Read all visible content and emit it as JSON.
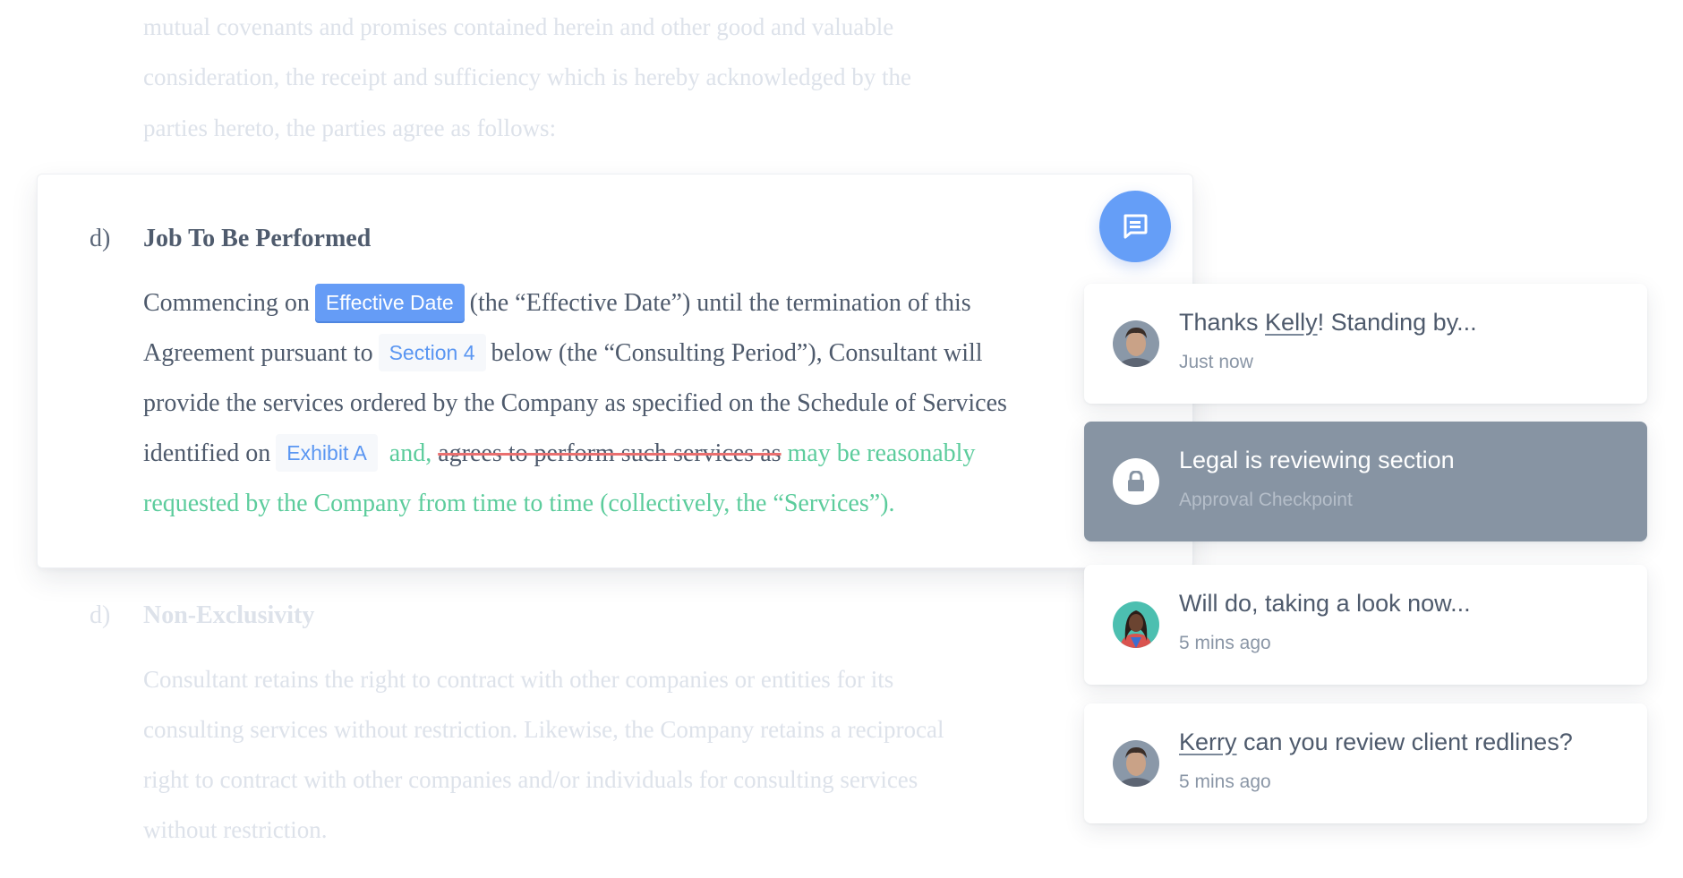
{
  "colors": {
    "accent_blue": "#659cf6",
    "insert_green": "#5ccc9c",
    "delete_red": "#ea6f6f",
    "locked_card": "#8794a3",
    "body_text": "#4e5a6c",
    "faded_text": "#dde2ea"
  },
  "preceding_paragraph": {
    "lines": [
      " mutual covenants and promises contained herein and other good and valuable",
      "consideration, the receipt and sufficiency which is hereby acknowledged by the",
      "parties hereto, the parties agree as follows:"
    ]
  },
  "active_section": {
    "number": "d)",
    "title": "Job To Be Performed",
    "line1": {
      "before": "Commencing on",
      "badge": "Effective Date",
      "after": "(the “Effective Date”) until the termination of this"
    },
    "line2": {
      "before": "Agreement pursuant to",
      "badge": "Section 4",
      "after": "below (the “Consulting Period”), Consultant will"
    },
    "line3": "provide the services ordered by the Company as specified on the Schedule of Services",
    "line4": {
      "before": "identified on",
      "badge": "Exhibit A",
      "inserted1": "and,",
      "deleted": "agrees to perform such services as",
      "inserted2": "may be reasonably"
    },
    "line5_inserted": "requested by the Company from time to time (collectively, the “Services”)."
  },
  "comment_button": {
    "icon": "comment-icon"
  },
  "next_section": {
    "number": "d)",
    "title": "Non-Exclusivity",
    "lines": [
      "Consultant retains the right to contract with other companies or entities for its",
      "consulting services without restriction. Likewise, the Company retains a reciprocal",
      "right to contract with other companies and/or individuals for consulting services",
      "without restriction."
    ]
  },
  "activity_feed": [
    {
      "type": "message",
      "avatar": "man-avatar",
      "mention": "Kelly",
      "text_before": "Thanks ",
      "text_after": "! Standing by...",
      "time": "Just now"
    },
    {
      "type": "checkpoint",
      "icon": "lock-icon",
      "text": "Legal is reviewing section",
      "subtitle": "Approval Checkpoint"
    },
    {
      "type": "message",
      "avatar": "woman-avatar",
      "text": "Will do, taking a look now...",
      "time": "5 mins ago"
    },
    {
      "type": "message",
      "avatar": "man-avatar",
      "mention": "Kerry",
      "text_after": " can you review client redlines?",
      "time": "5 mins ago"
    }
  ]
}
